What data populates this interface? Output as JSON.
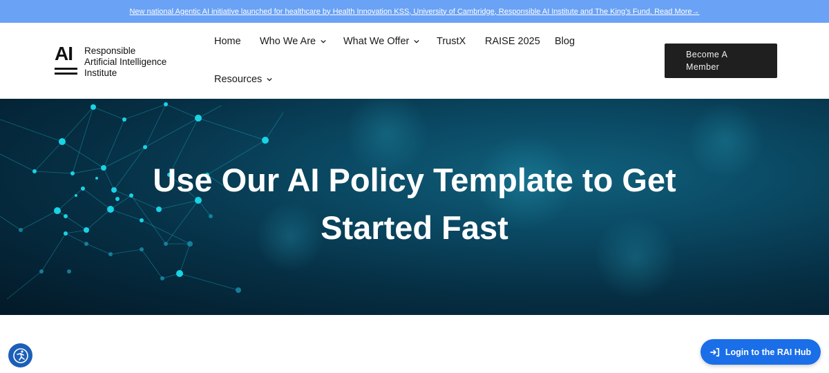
{
  "announcement": {
    "text": "New national Agentic AI initiative launched for healthcare by Health Innovation KSS, University of Cambridge, Responsible AI Institute and The King’s Fund. Read More→",
    "bg_color": "#6aa2f5"
  },
  "header": {
    "logo": {
      "mark": "AI",
      "line1": "Responsible",
      "line2": "Artificial Intelligence",
      "line3": "Institute"
    },
    "nav": [
      {
        "label": "Home",
        "has_dropdown": false
      },
      {
        "label": "Who We Are",
        "has_dropdown": true
      },
      {
        "label": "What We Offer",
        "has_dropdown": true
      },
      {
        "label": "TrustX",
        "has_dropdown": false
      },
      {
        "label": "RAISE 2025",
        "has_dropdown": false
      },
      {
        "label": "Blog",
        "has_dropdown": false
      },
      {
        "label": "Resources",
        "has_dropdown": true
      }
    ],
    "cta": {
      "line1": "Become A",
      "line2": "Member",
      "bg_color": "#1f1f1f"
    }
  },
  "hero": {
    "title_line1": "Use Our AI Policy Template to Get",
    "title_line2": "Started Fast",
    "accent_color": "#19d3e6"
  },
  "widgets": {
    "accessibility_icon": "accessibility-icon",
    "login_label": "Login to the RAI Hub",
    "login_icon": "sign-in-icon",
    "login_color": "#1a6ee8"
  }
}
